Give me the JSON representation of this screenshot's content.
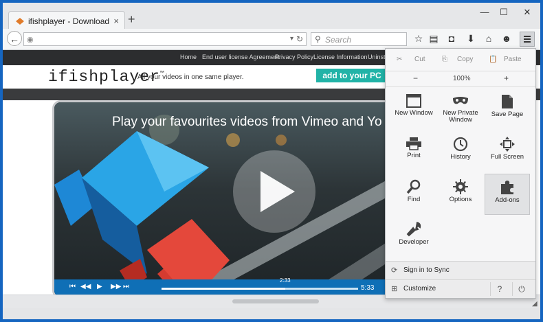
{
  "browser": {
    "tab_title": "ifishplayer - Download",
    "tab_close": "×",
    "new_tab": "+",
    "window_controls": {
      "minimize": "—",
      "maximize": "☐",
      "close": "✕"
    },
    "search_placeholder": "Search"
  },
  "site": {
    "nav": [
      "Home",
      "End user license Agreement",
      "Privacy Policy",
      "License Information",
      "Uninst"
    ],
    "logo": "ifishplayer",
    "logo_tm": "™",
    "tagline": "All your videos in one same player.",
    "cta": "add to your PC",
    "headline": "Play your favourites videos from Vimeo and Yo",
    "player": {
      "current_time": "2:33",
      "duration": "5:33",
      "progress": 0.63
    }
  },
  "menu": {
    "cut": "Cut",
    "copy": "Copy",
    "paste": "Paste",
    "zoom_out": "−",
    "zoom": "100%",
    "zoom_in": "+",
    "items": [
      {
        "label": "New Window",
        "icon": "new-window-icon"
      },
      {
        "label": "New Private Window",
        "icon": "private-mask-icon"
      },
      {
        "label": "Save Page",
        "icon": "save-page-icon"
      },
      {
        "label": "Print",
        "icon": "print-icon"
      },
      {
        "label": "History",
        "icon": "history-clock-icon"
      },
      {
        "label": "Full Screen",
        "icon": "fullscreen-icon"
      },
      {
        "label": "Find",
        "icon": "find-magnifier-icon"
      },
      {
        "label": "Options",
        "icon": "options-gear-icon"
      },
      {
        "label": "Add-ons",
        "icon": "addons-puzzle-icon"
      },
      {
        "label": "Developer",
        "icon": "developer-wrench-icon"
      }
    ],
    "sign_in": "Sign in to Sync",
    "customize": "Customize"
  }
}
